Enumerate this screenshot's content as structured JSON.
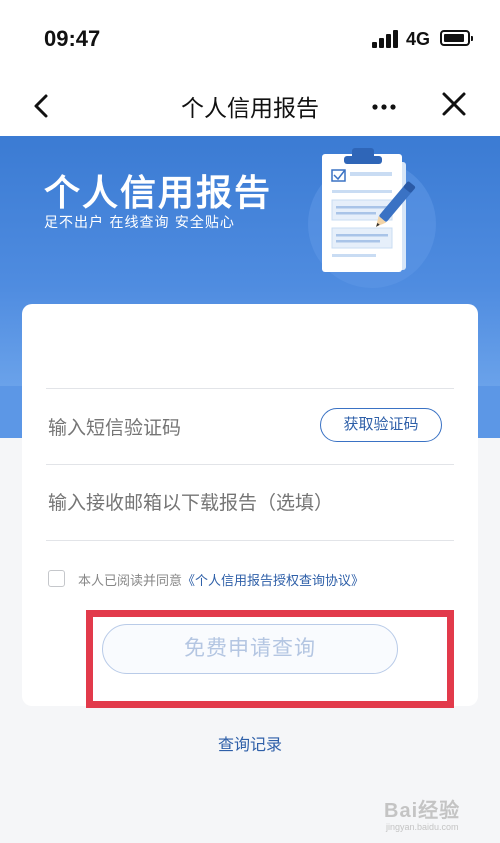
{
  "status_bar": {
    "time": "09:47",
    "network": "4G"
  },
  "nav": {
    "title": "个人信用报告",
    "icons": {
      "back": "chevron-left-icon",
      "more": "more-icon",
      "close": "close-icon"
    }
  },
  "banner": {
    "title": "个人信用报告",
    "subtitle": "足不出户 在线查询 安全贴心",
    "illustration": "clipboard-report-illustration"
  },
  "form": {
    "sms_code": {
      "placeholder": "输入短信验证码",
      "value": ""
    },
    "get_code_label": "获取验证码",
    "email": {
      "placeholder": "输入接收邮箱以下载报告（选填）",
      "value": ""
    },
    "agreement": {
      "checked": false,
      "prefix": "本人已阅读并同意",
      "link": "《个人信用报告授权查询协议》"
    },
    "submit_label": "免费申请查询"
  },
  "history_link": "查询记录",
  "watermark": {
    "text": "Bai经验",
    "url": "jingyan.baidu.com"
  },
  "colors": {
    "accent": "#3a72c4",
    "banner_top": "#3b7bd3",
    "highlight": "#e23a4b",
    "link": "#2e5fa8"
  }
}
